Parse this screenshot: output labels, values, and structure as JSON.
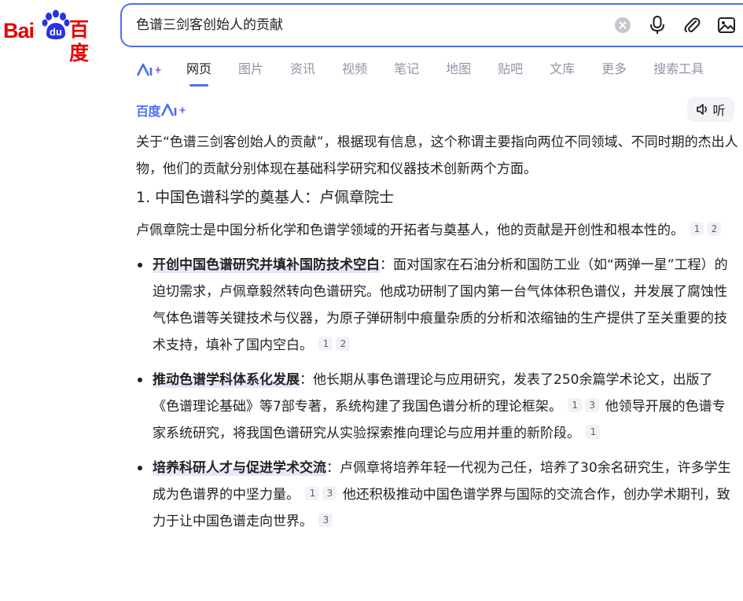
{
  "logo": {
    "bai": "Bai",
    "du": "du",
    "cn": "百度"
  },
  "search": {
    "query": "色谱三剑客创始人的贡献"
  },
  "tabs": [
    {
      "label": "网页"
    },
    {
      "label": "图片"
    },
    {
      "label": "资讯"
    },
    {
      "label": "视频"
    },
    {
      "label": "笔记"
    },
    {
      "label": "地图"
    },
    {
      "label": "贴吧"
    },
    {
      "label": "文库"
    },
    {
      "label": "更多"
    },
    {
      "label": "搜索工具"
    }
  ],
  "ai_header": {
    "brand": "百度",
    "listen": "听"
  },
  "content": {
    "intro": "关于“色谱三剑客创始人的贡献”，根据现有信息，这个称谓主要指向两位不同领域、不同时期的杰出人物，他们的贡献分别体现在基础科学研究和仪器技术创新两个方面。",
    "heading1": "1. 中国色谱科学的奠基人：卢佩章院士",
    "para1": "卢佩章院士是中国分析化学和色谱学领域的开拓者与奠基人，他的贡献是开创性和根本性的。",
    "para1_cites": [
      "1",
      "2"
    ],
    "bullets": [
      {
        "title": "开创中国色谱研究并填补国防技术空白",
        "text1": "：面对国家在石油分析和国防工业（如“两弹一星”工程）的迫切需求，卢佩章毅然转向色谱研究。他成功研制了国内第一台气体体积色谱仪，并发展了腐蚀性气体色谱等关键技术与仪器，为原子弹研制中痕量杂质的分析和浓缩铀的生产提供了至关重要的技术支持，填补了国内空白。",
        "cites1": [
          "1",
          "2"
        ]
      },
      {
        "title": "推动色谱学科体系化发展",
        "text1": "：他长期从事色谱理论与应用研究，发表了250余篇学术论文，出版了《色谱理论基础》等7部专著，系统构建了我国色谱分析的理论框架。",
        "cites1": [
          "1",
          "3"
        ],
        "text2": "他领导开展的色谱专家系统研究，将我国色谱研究从实验探索推向理论与应用并重的新阶段。",
        "cites2": [
          "1"
        ]
      },
      {
        "title": "培养科研人才与促进学术交流",
        "text1": "：卢佩章将培养年轻一代视为己任，培养了30余名研究生，许多学生成为色谱界的中坚力量。",
        "cites1": [
          "1",
          "3"
        ],
        "text2": "他还积极推动中国色谱学界与国际的交流合作，创办学术期刊，致力于让中国色谱走向世界。",
        "cites2": [
          "3"
        ]
      }
    ]
  },
  "colors": {
    "brand_red": "#e10602",
    "brand_blue": "#4e6ef2",
    "text": "#222226",
    "muted": "#9195a3"
  }
}
